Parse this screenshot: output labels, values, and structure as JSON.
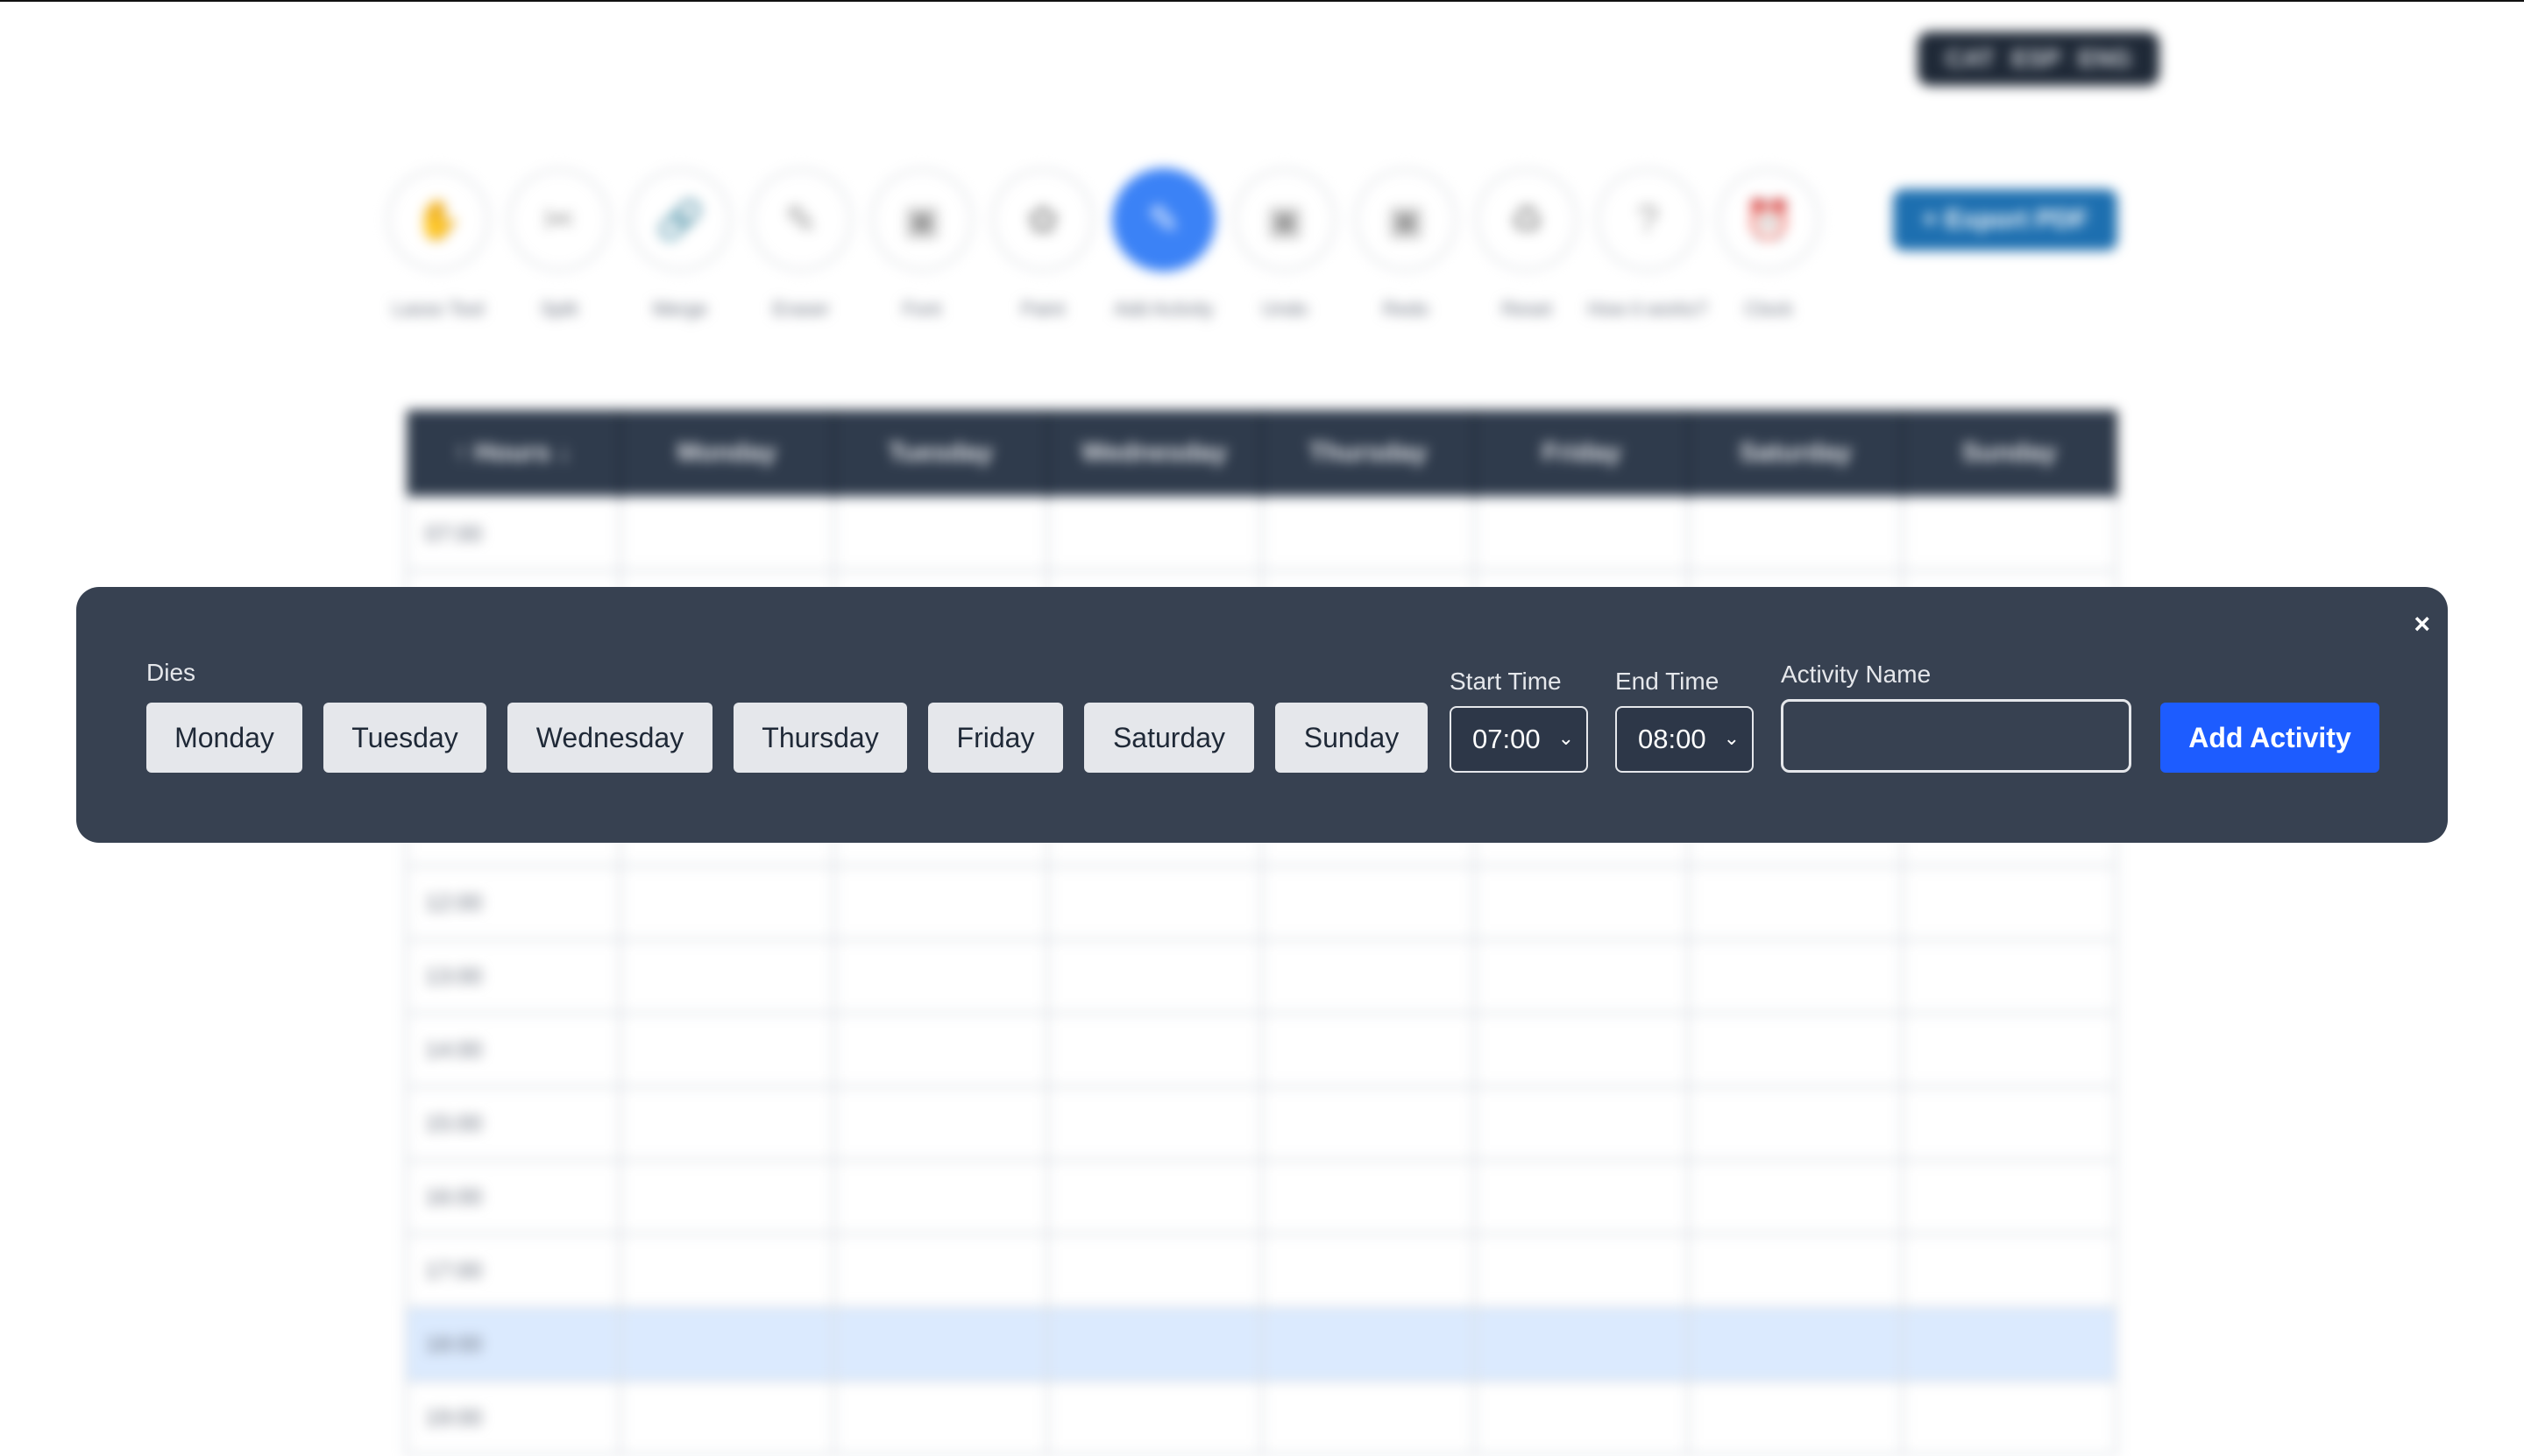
{
  "background": {
    "language_switch": [
      "CAT",
      "ESP",
      "ENG"
    ],
    "toolbar": [
      {
        "icon": "hand-icon",
        "glyph": "✋",
        "label": "Lasso Tool"
      },
      {
        "icon": "scissors-icon",
        "glyph": "✂",
        "label": "Split"
      },
      {
        "icon": "link-icon",
        "glyph": "🔗",
        "label": "Merge"
      },
      {
        "icon": "eraser-icon",
        "glyph": "✎",
        "label": "Eraser"
      },
      {
        "icon": "font-icon",
        "glyph": "▣",
        "label": "Font"
      },
      {
        "icon": "paint-icon",
        "glyph": "✿",
        "label": "Paint"
      },
      {
        "icon": "edit-icon",
        "glyph": "✎",
        "label": "Add Activity",
        "active": true
      },
      {
        "icon": "undo-icon",
        "glyph": "▣",
        "label": "Undo"
      },
      {
        "icon": "redo-icon",
        "glyph": "▣",
        "label": "Redo"
      },
      {
        "icon": "recycle-icon",
        "glyph": "♻",
        "label": "Reset"
      },
      {
        "icon": "question-icon",
        "glyph": "?",
        "label": "How it works?"
      },
      {
        "icon": "clock-icon",
        "glyph": "⏰",
        "label": "Clock"
      }
    ],
    "export_label": "+ Export PDF",
    "table": {
      "headers": [
        "↑ Hours ↓",
        "Monday",
        "Tuesday",
        "Wednesday",
        "Thursday",
        "Friday",
        "Saturday",
        "Sunday"
      ],
      "rows_top": [
        "07:00",
        ""
      ],
      "rows_bottom": [
        "12:00",
        "13:00",
        "14:00",
        "15:00",
        "16:00",
        "17:00",
        "18:00",
        "19:00"
      ],
      "highlighted_row": "18:00"
    }
  },
  "modal": {
    "close_label": "×",
    "days_label": "Dies",
    "days": [
      "Monday",
      "Tuesday",
      "Wednesday",
      "Thursday",
      "Friday",
      "Saturday",
      "Sunday"
    ],
    "start_time_label": "Start Time",
    "start_time_value": "07:00",
    "end_time_label": "End Time",
    "end_time_value": "08:00",
    "activity_name_label": "Activity Name",
    "activity_name_value": "",
    "add_button_label": "Add Activity"
  }
}
